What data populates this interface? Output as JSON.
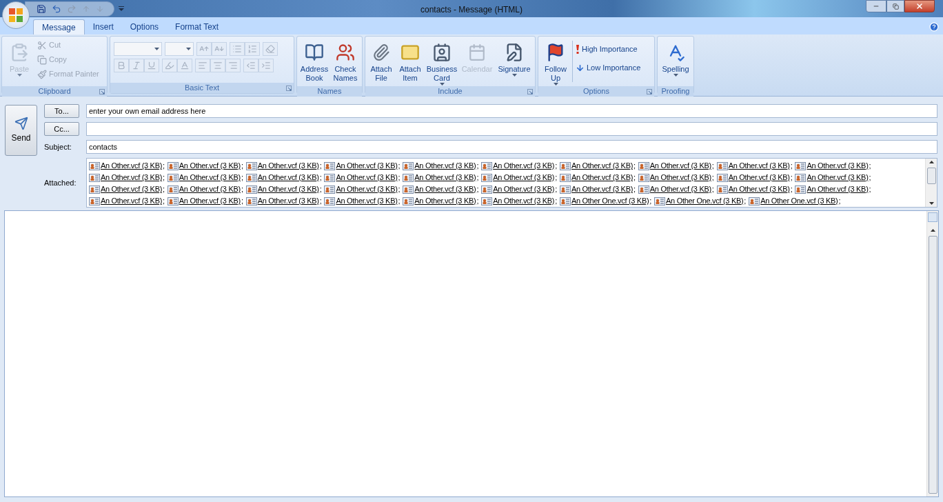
{
  "window": {
    "title": "contacts - Message (HTML)"
  },
  "ribbon_tabs": [
    {
      "label": "Message",
      "selected": true
    },
    {
      "label": "Insert",
      "selected": false
    },
    {
      "label": "Options",
      "selected": false
    },
    {
      "label": "Format Text",
      "selected": false
    }
  ],
  "ribbon": {
    "clipboard": {
      "title": "Clipboard",
      "paste": {
        "label": "Paste",
        "disabled": true
      },
      "cut": {
        "label": "Cut",
        "disabled": true
      },
      "copy": {
        "label": "Copy",
        "disabled": true
      },
      "format_painter": {
        "label": "Format Painter",
        "disabled": true
      }
    },
    "basic_text": {
      "title": "Basic Text",
      "disabled": true
    },
    "names": {
      "title": "Names",
      "address_book": {
        "label": "Address Book"
      },
      "check_names": {
        "label": "Check Names"
      }
    },
    "include": {
      "title": "Include",
      "attach_file": {
        "label": "Attach File",
        "disabled": false
      },
      "attach_item": {
        "label": "Attach Item",
        "disabled": false
      },
      "business_card": {
        "label": "Business Card",
        "disabled": false
      },
      "calendar": {
        "label": "Calendar",
        "disabled": true
      },
      "signature": {
        "label": "Signature",
        "disabled": false
      }
    },
    "options": {
      "title": "Options",
      "follow_up": {
        "label": "Follow Up"
      },
      "high_importance": {
        "label": "High Importance"
      },
      "low_importance": {
        "label": "Low Importance"
      }
    },
    "proofing": {
      "title": "Proofing",
      "spelling": {
        "label": "Spelling"
      }
    }
  },
  "compose": {
    "send": {
      "label": "Send"
    },
    "to": {
      "label": "To...",
      "value": "enter your own email address here"
    },
    "cc": {
      "label": "Cc..."
    },
    "subject": {
      "label": "Subject:",
      "value": "contacts"
    },
    "attached_label": "Attached:",
    "separator": ";",
    "attachments": [
      {
        "name": "An Other.vcf (3 KB)"
      },
      {
        "name": "An Other.vcf (3 KB)"
      },
      {
        "name": "An Other.vcf (3 KB)"
      },
      {
        "name": "An Other.vcf (3 KB)"
      },
      {
        "name": "An Other.vcf (3 KB)"
      },
      {
        "name": "An Other.vcf (3 KB)"
      },
      {
        "name": "An Other.vcf (3 KB)"
      },
      {
        "name": "An Other.vcf (3 KB)"
      },
      {
        "name": "An Other.vcf (3 KB)"
      },
      {
        "name": "An Other.vcf (3 KB)"
      },
      {
        "name": "An Other.vcf (3 KB)"
      },
      {
        "name": "An Other.vcf (3 KB)"
      },
      {
        "name": "An Other.vcf (3 KB)"
      },
      {
        "name": "An Other.vcf (3 KB)"
      },
      {
        "name": "An Other.vcf (3 KB)"
      },
      {
        "name": "An Other.vcf (3 KB)"
      },
      {
        "name": "An Other.vcf (3 KB)"
      },
      {
        "name": "An Other.vcf (3 KB)"
      },
      {
        "name": "An Other.vcf (3 KB)"
      },
      {
        "name": "An Other.vcf (3 KB)"
      },
      {
        "name": "An Other.vcf (3 KB)"
      },
      {
        "name": "An Other.vcf (3 KB)"
      },
      {
        "name": "An Other.vcf (3 KB)"
      },
      {
        "name": "An Other.vcf (3 KB)"
      },
      {
        "name": "An Other.vcf (3 KB)"
      },
      {
        "name": "An Other.vcf (3 KB)"
      },
      {
        "name": "An Other.vcf (3 KB)"
      },
      {
        "name": "An Other.vcf (3 KB)"
      },
      {
        "name": "An Other.vcf (3 KB)"
      },
      {
        "name": "An Other.vcf (3 KB)"
      },
      {
        "name": "An Other.vcf (3 KB)"
      },
      {
        "name": "An Other.vcf (3 KB)"
      },
      {
        "name": "An Other.vcf (3 KB)"
      },
      {
        "name": "An Other.vcf (3 KB)"
      },
      {
        "name": "An Other.vcf (3 KB)"
      },
      {
        "name": "An Other.vcf (3 KB)"
      },
      {
        "name": "An Other One.vcf (3 KB)"
      },
      {
        "name": "An Other One.vcf (3 KB)"
      },
      {
        "name": "An Other One.vcf (3 KB)"
      }
    ]
  }
}
